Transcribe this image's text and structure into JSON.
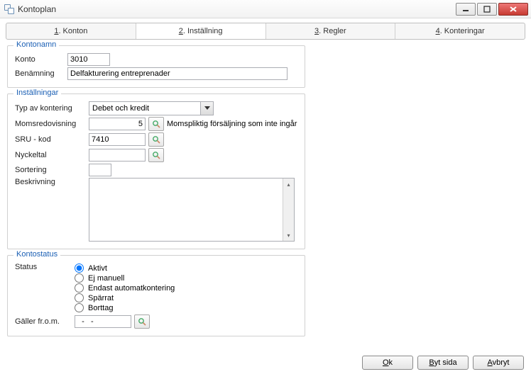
{
  "window": {
    "title": "Kontoplan"
  },
  "tabs": [
    {
      "prefix": "1",
      "label": ". Konton"
    },
    {
      "prefix": "2",
      "label": ". Inställning"
    },
    {
      "prefix": "3",
      "label": ". Regler"
    },
    {
      "prefix": "4",
      "label": ". Konteringar"
    }
  ],
  "active_tab": 1,
  "kontonamn": {
    "legend": "Kontonamn",
    "konto_label": "Konto",
    "konto_value": "3010",
    "benamning_label": "Benämning",
    "benamning_value": "Delfakturering entreprenader"
  },
  "installningar": {
    "legend": "Inställningar",
    "typ_label": "Typ av kontering",
    "typ_value": "Debet och kredit",
    "moms_label": "Momsredovisning",
    "moms_value": "5",
    "moms_desc": "Momspliktig försäljning som inte ingår i annan ruta ne",
    "sru_label": "SRU - kod",
    "sru_value": "7410",
    "nyckeltal_label": "Nyckeltal",
    "nyckeltal_value": "",
    "sortering_label": "Sortering",
    "sortering_value": "",
    "beskrivning_label": "Beskrivning",
    "beskrivning_value": ""
  },
  "kontostatus": {
    "legend": "Kontostatus",
    "status_label": "Status",
    "options": {
      "aktivt": "Aktivt",
      "ej_manuell": "Ej manuell",
      "endast_auto": "Endast automatkontering",
      "sparrat": "Spärrat",
      "borttag": "Borttag"
    },
    "selected": "aktivt",
    "from_label": "Gäller fr.o.m.",
    "from_value": "  -   -"
  },
  "buttons": {
    "ok_u": "O",
    "ok_rest": "k",
    "bytsida_u": "B",
    "bytsida_rest": "yt sida",
    "avbryt_u": "A",
    "avbryt_rest": "vbryt"
  }
}
